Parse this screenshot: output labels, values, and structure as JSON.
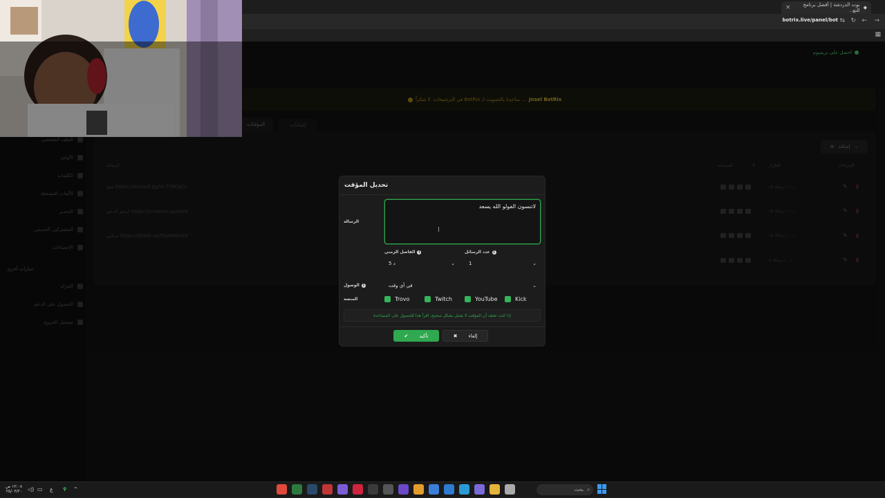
{
  "browser": {
    "tab_title": "بوت الدردشة | أفضل برنامج للتع..",
    "url": "botrix.live/panel/bot"
  },
  "page": {
    "status": "احصل على بريميوم",
    "banner_prefix": "Jnsel BotRix",
    "banner_text": "... ساعدنا بالتصويت لـ BotRix في الترشيحات",
    "banner_suffix": "لا شكراً"
  },
  "sidebar": {
    "items": [
      "الملف الشخصي",
      "الأوامر",
      "الكلمات",
      "الألعاب المسجلة",
      "التحذير",
      "المشتركين الحديثين",
      "الإحصاءات"
    ],
    "header": "خيارات أخرى",
    "more_items": [
      "الحزام",
      "الحصول على الدعم",
      "تسجيل الخروج"
    ]
  },
  "tabs": {
    "timers": "المؤقتات",
    "settings": "إعدادات"
  },
  "table": {
    "add_button": "إضافة",
    "headers": {
      "message": "الرسالة",
      "platforms": "المنصات",
      "frequency": "التكرار",
      "actions": "الإجراءات"
    },
    "rows": [
      {
        "message": "https://discord.gg/Uc7YKCpCx متح",
        "frequency": "د - ١ رسالة ١٥"
      },
      {
        "message": "https://creators.sa/oefo لدعم الدعم",
        "frequency": "د - ١ رسالة ١٥"
      },
      {
        "message": "https://tiktok.se/OSAMAH10 سنابي",
        "frequency": "د - ١ رسالة ١٥"
      },
      {
        "message": "",
        "frequency": "د - ١ رسالة ٥"
      }
    ]
  },
  "modal": {
    "title": "تحديل المؤقت",
    "message_label": "الرسالة",
    "message_value": "لاتنسون الفولو الله يسعد",
    "interval_label": "الفاصل الزمني",
    "interval_value": "5 د",
    "count_label": "عدد الرسائل",
    "count_value": "1",
    "reach_label": "الوصول",
    "reach_value": "في أي وقت",
    "platform_label": "المنصة",
    "platforms": [
      "Trovo",
      "Twitch",
      "YouTube",
      "Kick"
    ],
    "note": "إذا كنت تعتقد أن المؤقت لا يعمل بشكل صحيح، اقرأ هذا للحصول على المساعدة",
    "confirm_label": "تأكيد",
    "cancel_label": "إلغاء"
  },
  "taskbar": {
    "time": "١٢:٠٨ ص",
    "date": "٢٥/٠٣/٢٠",
    "search_placeholder": "بحث",
    "lang": "ع"
  },
  "colors": {
    "accent": "#2fa84f",
    "banner": "#a48a1c",
    "danger": "#6a2a2a"
  }
}
